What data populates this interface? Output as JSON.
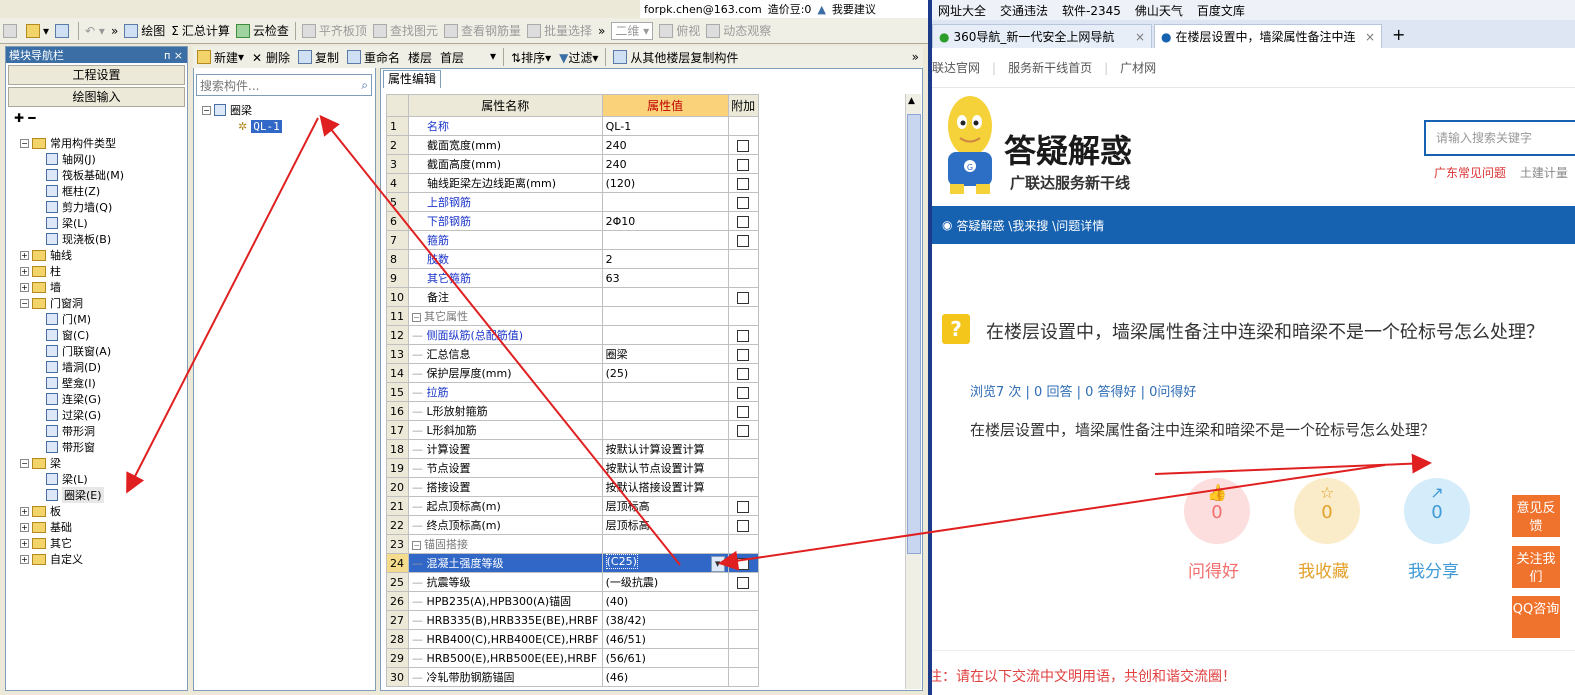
{
  "top": {
    "email": "forpk.chen@163.com",
    "price_label": "造价豆:0",
    "suggest": "我要建议"
  },
  "toolbar": {
    "draw": "绘图",
    "calc": "汇总计算",
    "check": "云检查",
    "flat": "平齐板顶",
    "find": "查找图元",
    "view_rebar": "查看钢筋量",
    "batch": "批量选择",
    "view_mode": "二维",
    "pitch": "俯视",
    "dynamic": "动态观察"
  },
  "nav": {
    "title": "模块导航栏",
    "pin": "ᴨ ×",
    "btn_project": "工程设置",
    "btn_draw": "绘图输入",
    "items": [
      {
        "label": "常用构件类型",
        "level": 0,
        "type": "folder",
        "exp": "−"
      },
      {
        "label": "轴网(J)",
        "level": 1,
        "type": "comp"
      },
      {
        "label": "筏板基础(M)",
        "level": 1,
        "type": "comp"
      },
      {
        "label": "框柱(Z)",
        "level": 1,
        "type": "comp"
      },
      {
        "label": "剪力墙(Q)",
        "level": 1,
        "type": "comp"
      },
      {
        "label": "梁(L)",
        "level": 1,
        "type": "comp"
      },
      {
        "label": "现浇板(B)",
        "level": 1,
        "type": "comp"
      },
      {
        "label": "轴线",
        "level": 0,
        "type": "folder",
        "exp": "+"
      },
      {
        "label": "柱",
        "level": 0,
        "type": "folder",
        "exp": "+"
      },
      {
        "label": "墙",
        "level": 0,
        "type": "folder",
        "exp": "+"
      },
      {
        "label": "门窗洞",
        "level": 0,
        "type": "folder",
        "exp": "−"
      },
      {
        "label": "门(M)",
        "level": 1,
        "type": "comp"
      },
      {
        "label": "窗(C)",
        "level": 1,
        "type": "comp"
      },
      {
        "label": "门联窗(A)",
        "level": 1,
        "type": "comp"
      },
      {
        "label": "墙洞(D)",
        "level": 1,
        "type": "comp"
      },
      {
        "label": "壁龛(I)",
        "level": 1,
        "type": "comp"
      },
      {
        "label": "连梁(G)",
        "level": 1,
        "type": "comp"
      },
      {
        "label": "过梁(G)",
        "level": 1,
        "type": "comp"
      },
      {
        "label": "带形洞",
        "level": 1,
        "type": "comp"
      },
      {
        "label": "带形窗",
        "level": 1,
        "type": "comp"
      },
      {
        "label": "梁",
        "level": 0,
        "type": "folder",
        "exp": "−"
      },
      {
        "label": "梁(L)",
        "level": 1,
        "type": "comp"
      },
      {
        "label": "圈梁(E)",
        "level": 1,
        "type": "comp",
        "selected": true
      },
      {
        "label": "板",
        "level": 0,
        "type": "folder",
        "exp": "+"
      },
      {
        "label": "基础",
        "level": 0,
        "type": "folder",
        "exp": "+"
      },
      {
        "label": "其它",
        "level": 0,
        "type": "folder",
        "exp": "+"
      },
      {
        "label": "自定义",
        "level": 0,
        "type": "folder",
        "exp": "+"
      }
    ]
  },
  "comp_toolbar": {
    "new": "新建",
    "delete": "删除",
    "copy": "复制",
    "rename": "重命名",
    "floor_lbl": "楼层",
    "floor_val": "首层",
    "sort": "排序",
    "filter": "过滤",
    "copy_from": "从其他楼层复制构件"
  },
  "comp_list": {
    "search_placeholder": "搜索构件...",
    "root": "圈梁",
    "child": "QL-1"
  },
  "props": {
    "tab": "属性编辑",
    "headers": [
      "属性名称",
      "属性值",
      "附加"
    ],
    "rows": [
      {
        "n": "1",
        "name": "名称",
        "val": "QL-1",
        "cb": false,
        "blue": true
      },
      {
        "n": "2",
        "name": "截面宽度(mm)",
        "val": "240",
        "cb": true
      },
      {
        "n": "3",
        "name": "截面高度(mm)",
        "val": "240",
        "cb": true
      },
      {
        "n": "4",
        "name": "轴线距梁左边线距离(mm)",
        "val": "(120)",
        "cb": true
      },
      {
        "n": "5",
        "name": "上部钢筋",
        "val": "",
        "cb": true,
        "blue": true
      },
      {
        "n": "6",
        "name": "下部钢筋",
        "val": "2Φ10",
        "cb": true,
        "blue": true
      },
      {
        "n": "7",
        "name": "箍筋",
        "val": "",
        "cb": true,
        "blue": true
      },
      {
        "n": "8",
        "name": "肢数",
        "val": "2",
        "cb": false,
        "blue": true
      },
      {
        "n": "9",
        "name": "其它箍筋",
        "val": "63",
        "cb": false,
        "blue": true
      },
      {
        "n": "10",
        "name": "备注",
        "val": "",
        "cb": true
      },
      {
        "n": "11",
        "name": "其它属性",
        "val": "",
        "cb": false,
        "group": true
      },
      {
        "n": "12",
        "name": "侧面纵筋(总配筋值)",
        "val": "",
        "cb": true,
        "blue": true,
        "sub": true
      },
      {
        "n": "13",
        "name": "汇总信息",
        "val": "圈梁",
        "cb": true,
        "sub": true
      },
      {
        "n": "14",
        "name": "保护层厚度(mm)",
        "val": "(25)",
        "cb": true,
        "sub": true
      },
      {
        "n": "15",
        "name": "拉筋",
        "val": "",
        "cb": true,
        "blue": true,
        "sub": true
      },
      {
        "n": "16",
        "name": "L形放射箍筋",
        "val": "",
        "cb": true,
        "sub": true
      },
      {
        "n": "17",
        "name": "L形斜加筋",
        "val": "",
        "cb": true,
        "sub": true
      },
      {
        "n": "18",
        "name": "计算设置",
        "val": "按默认计算设置计算",
        "cb": false,
        "sub": true
      },
      {
        "n": "19",
        "name": "节点设置",
        "val": "按默认节点设置计算",
        "cb": false,
        "sub": true
      },
      {
        "n": "20",
        "name": "搭接设置",
        "val": "按默认搭接设置计算",
        "cb": false,
        "sub": true
      },
      {
        "n": "21",
        "name": "起点顶标高(m)",
        "val": "层顶标高",
        "cb": true,
        "sub": true
      },
      {
        "n": "22",
        "name": "终点顶标高(m)",
        "val": "层顶标高",
        "cb": true,
        "sub": true
      },
      {
        "n": "23",
        "name": "锚固搭接",
        "val": "",
        "cb": false,
        "group": true
      },
      {
        "n": "24",
        "name": "混凝土强度等级",
        "val": "(C25)",
        "cb": true,
        "sub": true,
        "sel": true
      },
      {
        "n": "25",
        "name": "抗震等级",
        "val": "(一级抗震)",
        "cb": true,
        "sub": true
      },
      {
        "n": "26",
        "name": "HPB235(A),HPB300(A)锚固",
        "val": "(40)",
        "cb": false,
        "sub": true
      },
      {
        "n": "27",
        "name": "HRB335(B),HRB335E(BE),HRBF",
        "val": "(38/42)",
        "cb": false,
        "sub": true
      },
      {
        "n": "28",
        "name": "HRB400(C),HRB400E(CE),HRBF",
        "val": "(46/51)",
        "cb": false,
        "sub": true
      },
      {
        "n": "29",
        "name": "HRB500(E),HRB500E(EE),HRBF",
        "val": "(56/61)",
        "cb": false,
        "sub": true
      },
      {
        "n": "30",
        "name": "冷轧带肋钢筋锚固",
        "val": "(46)",
        "cb": false,
        "sub": true
      }
    ]
  },
  "browser": {
    "bookmarks": [
      "网址大全",
      "交通违法",
      "软件-2345",
      "佛山天气",
      "百度文库"
    ],
    "tabs": [
      {
        "title": "360导航_新一代安全上网导航",
        "active": false
      },
      {
        "title": "在楼层设置中，墙梁属性备注中连",
        "active": true
      }
    ],
    "new_tab": "+",
    "links": [
      "联达官网",
      "服务新干线首页",
      "广材网"
    ],
    "logo_title": "答疑解惑",
    "logo_sub": "广联达服务新干线",
    "search_placeholder": "请输入搜索关键字",
    "hot": [
      "广东常见问题",
      "土建计量"
    ],
    "breadcrumb": "答疑解惑 \\我来搜 \\问题详情",
    "question_icon": "?",
    "question_title": "在楼层设置中，墙梁属性备注中连梁和暗梁不是一个砼标号怎么处理？",
    "stats": "浏览7 次 | 0 回答 | 0 答得好 | 0问得好",
    "question_body": "在楼层设置中，墙梁属性备注中连梁和暗梁不是一个砼标号怎么处理？",
    "actions": [
      {
        "count": "0",
        "label": "问得好",
        "color": "#f26e6e",
        "bg": "#fcdede"
      },
      {
        "count": "0",
        "label": "我收藏",
        "color": "#e3a12a",
        "bg": "#fbecc9"
      },
      {
        "count": "0",
        "label": "我分享",
        "color": "#3f9ad6",
        "bg": "#d5ecfa"
      }
    ],
    "side_buttons": [
      "意见反馈",
      "关注我们",
      "QQ咨询"
    ],
    "notice": "注：请在以下交流中文明用语，共创和谐交流圈！"
  },
  "colors": {
    "accent": "#1762b0",
    "arrow": "#e02020",
    "selected": "#3167c6"
  }
}
